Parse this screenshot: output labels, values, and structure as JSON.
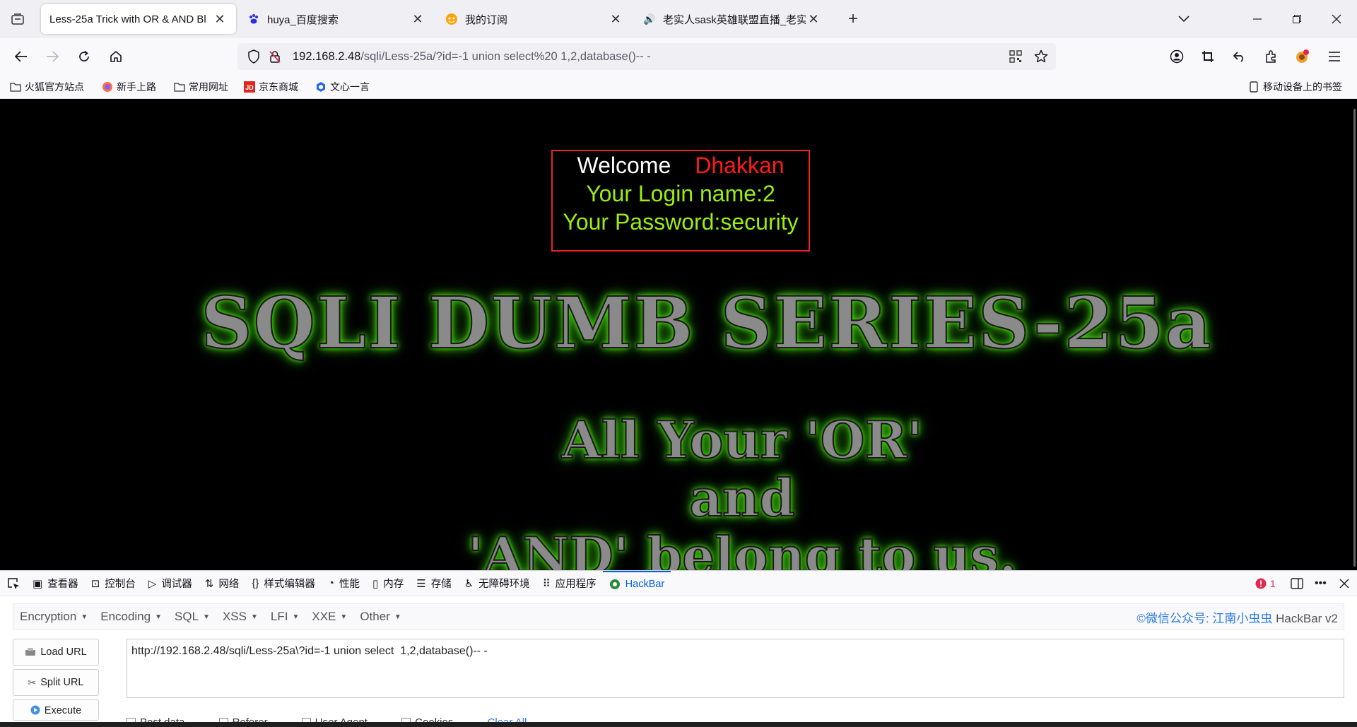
{
  "tabs": [
    {
      "title": "Less-25a Trick with OR & AND Bl",
      "icon": "document-icon",
      "active": true
    },
    {
      "title": "huya_百度搜索",
      "icon": "baidu-paw-icon",
      "active": false
    },
    {
      "title": "我的订阅",
      "icon": "huya-icon",
      "active": false
    },
    {
      "title": "老实人sask英雄联盟直播_老实人",
      "icon": "speaker-icon",
      "active": false
    }
  ],
  "url": {
    "host": "192.168.2.48",
    "path": "/sqli/Less-25a/?id=-1 union select%20 1,2,database()-- -"
  },
  "bookmarks": [
    {
      "label": "火狐官方站点",
      "icon": "folder-icon"
    },
    {
      "label": "新手上路",
      "icon": "firefox-icon"
    },
    {
      "label": "常用网址",
      "icon": "folder-icon"
    },
    {
      "label": "京东商城",
      "icon": "jd-icon"
    },
    {
      "label": "文心一言",
      "icon": "wenxin-icon"
    }
  ],
  "mobile_bookmarks": "移动设备上的书签",
  "page": {
    "welcome": "Welcome",
    "user": "Dhakkan",
    "login_name": "Your Login name:2",
    "password": "Your Password:security",
    "banner_title": "SQLI DUMB SERIES-25a",
    "banner_line1": "All Your 'OR'",
    "banner_line2": "and",
    "banner_line3": "'AND' belong to us."
  },
  "devtools": {
    "tabs": [
      {
        "label": "查看器",
        "icon": "inspector-icon"
      },
      {
        "label": "控制台",
        "icon": "console-icon"
      },
      {
        "label": "调试器",
        "icon": "debugger-icon"
      },
      {
        "label": "网络",
        "icon": "network-icon"
      },
      {
        "label": "样式编辑器",
        "icon": "style-editor-icon"
      },
      {
        "label": "性能",
        "icon": "performance-icon"
      },
      {
        "label": "内存",
        "icon": "memory-icon"
      },
      {
        "label": "存储",
        "icon": "storage-icon"
      },
      {
        "label": "无障碍环境",
        "icon": "accessibility-icon"
      },
      {
        "label": "应用程序",
        "icon": "application-icon"
      },
      {
        "label": "HackBar",
        "icon": "hackbar-icon",
        "active": true
      }
    ],
    "error_count": "1"
  },
  "hackbar": {
    "menus": [
      "Encryption",
      "Encoding",
      "SQL",
      "XSS",
      "LFI",
      "XXE",
      "Other"
    ],
    "brand_prefix": "©微信公众号: ",
    "brand_name": "江南小虫虫",
    "brand_suffix": " HackBar v2",
    "load_url": "Load URL",
    "split_url": "Split URL",
    "execute": "Execute",
    "url_value": "http://192.168.2.48/sqli/Less-25a\\?id=-1 union select  1,2,database()-- -\n",
    "checks": [
      "Post data",
      "Referer",
      "User Agent",
      "Cookies"
    ],
    "clear_all": "Clear All"
  },
  "colors": {
    "accent": "#0060df",
    "welcome_red": "#ff1a1a",
    "login_green": "#99ee11",
    "glow_green": "#5cff1a"
  }
}
